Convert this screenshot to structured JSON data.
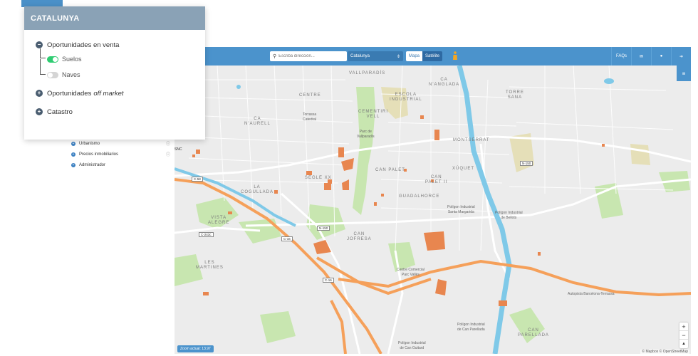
{
  "sidebar_back": {
    "items": [
      {
        "label": "Urbanismo"
      },
      {
        "label": "Precios inmobiliarios"
      },
      {
        "label": "Administrador"
      }
    ]
  },
  "panel": {
    "title": "CATALUNYA",
    "sections": [
      {
        "label": "Oportunidades en venta",
        "expanded": true
      },
      {
        "label": "Oportunidades",
        "label_italic": "off market",
        "expanded": false
      },
      {
        "label": "Catastro",
        "expanded": false
      }
    ],
    "subitems": [
      {
        "label": "Suelos",
        "enabled": true
      },
      {
        "label": "Naves",
        "enabled": false
      }
    ]
  },
  "topbar": {
    "search_placeholder": "Escriba dirección...",
    "region": "Catalunya",
    "map_btn": "Mapa",
    "satellite_btn": "Satélite",
    "faqs": "FAQs"
  },
  "map": {
    "labels": {
      "vallparadis": "VALLPARADÍS",
      "ca_nanglada": "CA\nN'ANGLADA",
      "torre_sana": "TORRE\nSANA",
      "centre": "CENTRE",
      "escola_industrial": "ESCOLA\nINDUSTRIAL",
      "ca_naurell": "CA\nN'AURELL",
      "cementiri_vell": "CEMENTIRI\nVELL",
      "montserrat": "MONTSERRAT",
      "xuquet": "XÚQUET",
      "can_palet": "CAN PALET",
      "can_palet_ii": "CAN\nPALET II",
      "segle_xx": "SEGLE XX",
      "la_cogullada": "LA\nCOGULLADA",
      "guadalhorce": "GUADALHORCE",
      "vista_alegre": "VISTA\nALEGRE",
      "can_jofresa": "CAN\nJOFRESA",
      "les_martines": "LES\nMARTINES",
      "can_parellada": "CAN\nPARELLADA",
      "parc_vallparadis": "Parc de\nVallparadís",
      "torrassa": "Torrassa\nCatedral",
      "poligon_santa_margarida": "Polígon Industrial\nSanta Margarida",
      "poligon_bellots": "Polígon Industrial\nde Bellots",
      "centre_comercial": "Centre Comercial\nParc Vallès",
      "poligon_parellada": "Polígon Industrial\nde Can Parellada",
      "poligon_guitard": "Polígon Industrial\nde Can Guitard",
      "autopista": "Autopista Barcelona-Terrassa",
      "snc": "SNC"
    },
    "shields": {
      "c58": "C-58",
      "b158": "N-150",
      "c243c": "C-243c",
      "c16": "C-16",
      "n150": "N-150",
      "c16b": "C-16"
    },
    "zoom_badge": "Zoom actual: 13.97",
    "attribution": "© Mapbox © OpenStreetMap"
  },
  "colors": {
    "topbar": "#4b93cc",
    "panel_header": "#8aa2b6",
    "toggle_on": "#2ecc71",
    "parcel": "#e8864f",
    "motorway": "#f5a05a",
    "river": "#7fc9e8",
    "park": "#c8e6b0"
  }
}
